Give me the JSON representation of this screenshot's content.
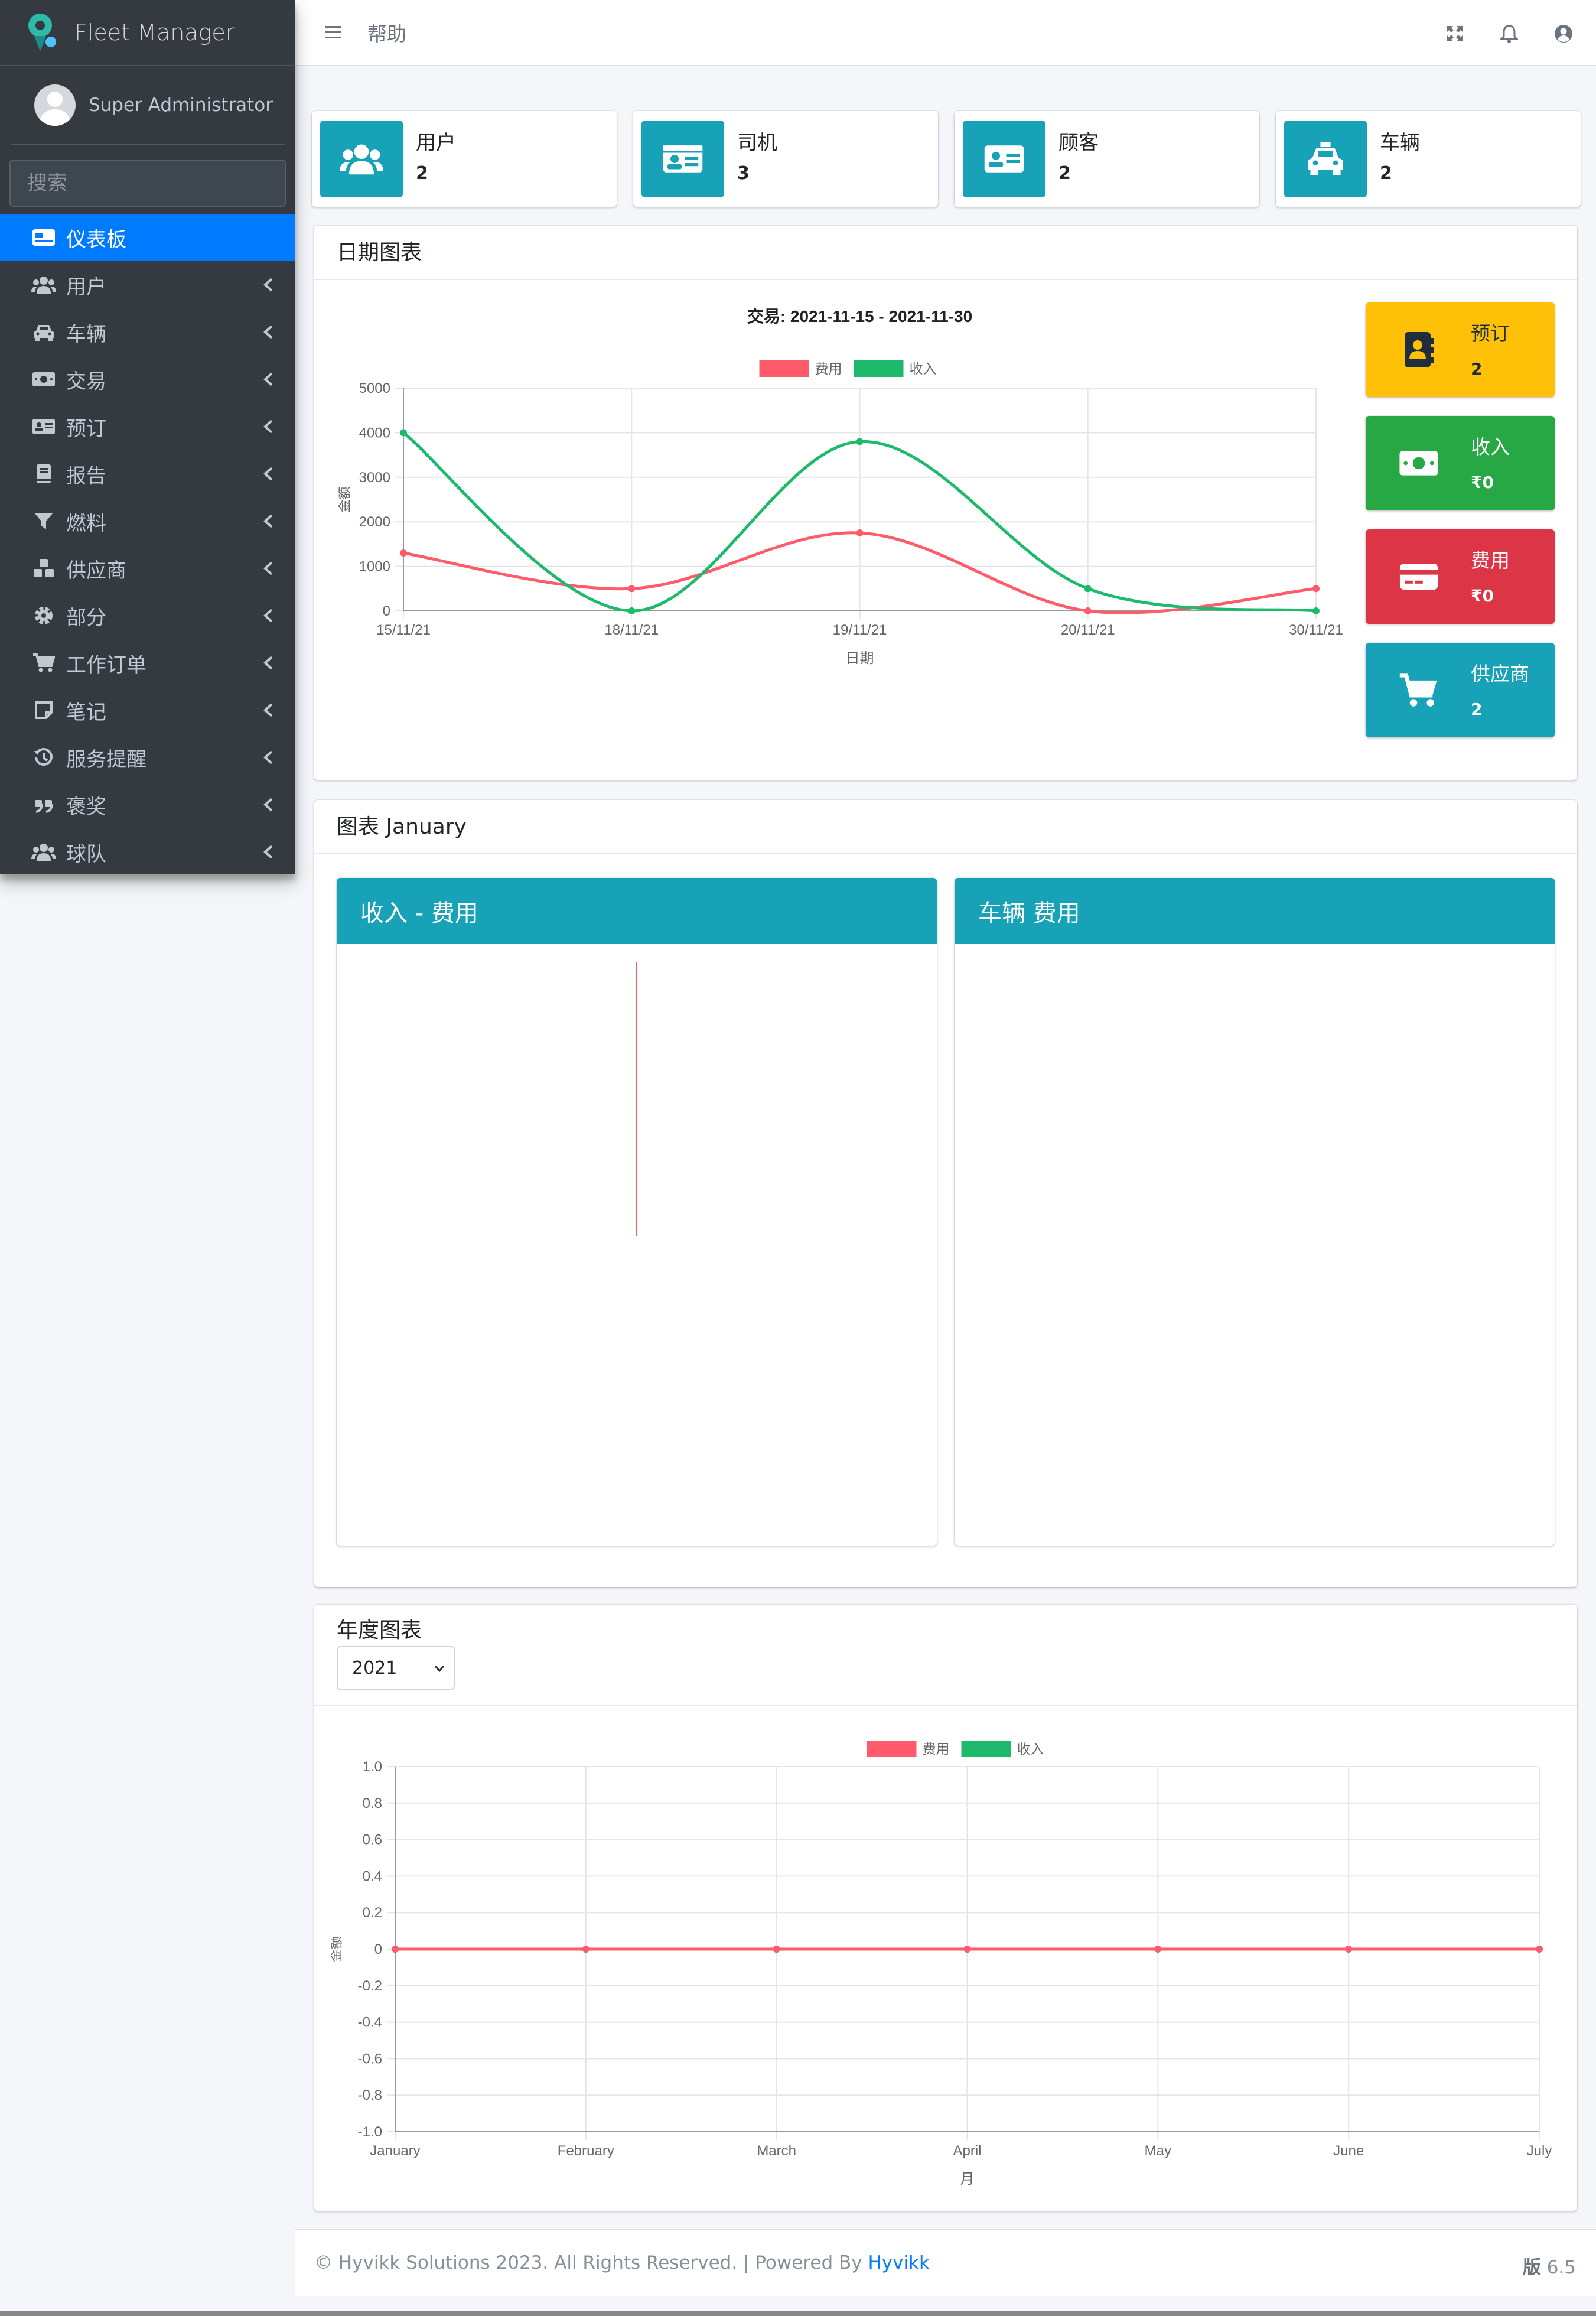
{
  "brand": {
    "name": "Fleet Manager"
  },
  "user": {
    "name": "Super Administrator"
  },
  "search": {
    "placeholder": "搜索"
  },
  "nav": [
    {
      "label": "仪表板",
      "icon": "dashboard-icon",
      "active": true
    },
    {
      "label": "用户",
      "icon": "users-icon"
    },
    {
      "label": "车辆",
      "icon": "car-icon"
    },
    {
      "label": "交易",
      "icon": "money-icon"
    },
    {
      "label": "预订",
      "icon": "id-card-icon"
    },
    {
      "label": "报告",
      "icon": "book-icon"
    },
    {
      "label": "燃料",
      "icon": "filter-icon"
    },
    {
      "label": "供应商",
      "icon": "cubes-icon"
    },
    {
      "label": "部分",
      "icon": "gear-icon"
    },
    {
      "label": "工作订单",
      "icon": "cart-icon"
    },
    {
      "label": "笔记",
      "icon": "sticky-note-icon"
    },
    {
      "label": "服务提醒",
      "icon": "history-icon"
    },
    {
      "label": "褒奖",
      "icon": "quote-icon"
    },
    {
      "label": "球队",
      "icon": "team-icon"
    }
  ],
  "topbar": {
    "help": "帮助"
  },
  "info_boxes": [
    {
      "label": "用户",
      "value": "2",
      "icon": "users-icon"
    },
    {
      "label": "司机",
      "value": "3",
      "icon": "driver-card-icon"
    },
    {
      "label": "顾客",
      "value": "2",
      "icon": "customer-card-icon"
    },
    {
      "label": "车辆",
      "value": "2",
      "icon": "car-icon"
    }
  ],
  "date_chart_card": {
    "title": "日期图表"
  },
  "small_boxes": [
    {
      "label": "预订",
      "value": "2",
      "color": "#ffc107",
      "icon": "address-book-icon"
    },
    {
      "label": "收入",
      "value": "₹0",
      "color": "#28a745",
      "icon": "money-bill-icon"
    },
    {
      "label": "费用",
      "value": "₹0",
      "color": "#dc3545",
      "icon": "credit-card-icon"
    },
    {
      "label": "供应商",
      "value": "2",
      "color": "#17a2b8",
      "icon": "cart-icon"
    }
  ],
  "month_card": {
    "title": "图表 January",
    "left_title": "收入 - 费用",
    "right_title": "车辆 费用"
  },
  "yearly_card": {
    "title": "年度图表",
    "year": "2021"
  },
  "footer": {
    "copyright": "© Hyvikk Solutions 2023. All Rights Reserved. | Powered By ",
    "link": "Hyvikk",
    "version_label": "版",
    "version": "6.5"
  },
  "colors": {
    "primary": "#007bff",
    "info": "#17a2b8",
    "expense": "#ff5b6a",
    "income": "#1dba6b"
  },
  "chart_data": [
    {
      "type": "line",
      "title": "交易: 2021-11-15 - 2021-11-30",
      "categories": [
        "15/11/21",
        "18/11/21",
        "19/11/21",
        "20/11/21",
        "30/11/21"
      ],
      "series": [
        {
          "name": "费用",
          "values": [
            1300,
            500,
            1750,
            0,
            500
          ]
        },
        {
          "name": "收入",
          "values": [
            4000,
            0,
            3800,
            500,
            0
          ]
        }
      ],
      "xlabel": "日期",
      "ylabel": "金额",
      "ylim": [
        0,
        5000
      ],
      "yticks": [
        0,
        1000,
        2000,
        3000,
        4000,
        5000
      ],
      "legend": "top",
      "grid": true
    },
    {
      "type": "line",
      "categories": [
        "January",
        "February",
        "March",
        "April",
        "May",
        "June",
        "July"
      ],
      "series": [
        {
          "name": "费用",
          "values": [
            0,
            0,
            0,
            0,
            0,
            0,
            0
          ]
        },
        {
          "name": "收入",
          "values": [
            0,
            0,
            0,
            0,
            0,
            0,
            0
          ]
        }
      ],
      "xlabel": "月",
      "ylabel": "金额",
      "ylim": [
        -1.0,
        1.0
      ],
      "yticks": [
        1.0,
        0.8,
        0.6,
        0.4,
        0.2,
        0,
        -0.2,
        -0.4,
        -0.6,
        -0.8,
        -1.0
      ],
      "legend": "top",
      "grid": true
    }
  ]
}
